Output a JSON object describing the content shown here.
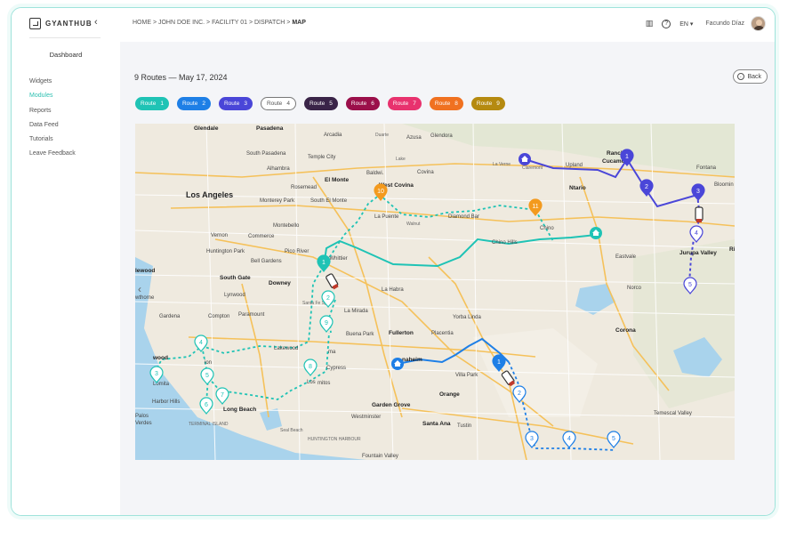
{
  "app": {
    "logo_text": "GYANTHUB",
    "collapse_glyph": "‹"
  },
  "sidebar": {
    "dashboard": "Dashboard",
    "items": [
      {
        "label": "Widgets",
        "active": false
      },
      {
        "label": "Modules",
        "active": true
      },
      {
        "label": "Reports",
        "active": false
      },
      {
        "label": "Data Feed",
        "active": false
      },
      {
        "label": "Tutorials",
        "active": false
      },
      {
        "label": "Leave Feedback",
        "active": false
      }
    ]
  },
  "header": {
    "breadcrumb": {
      "path": "HOME > JOHN DOE INC. > FACILITY  01 > DISPATCH > ",
      "current": "MAP"
    },
    "chart_icon": "▥",
    "help_icon": "?",
    "language": "EN ▾",
    "user_name": "Facundo Díaz"
  },
  "page": {
    "title": "9 Routes — May 17, 2024",
    "back_label": "Back"
  },
  "routes": [
    {
      "label": "Route",
      "num": "1",
      "color": "#1fc3b5",
      "text": "#ffffff",
      "outlined": false
    },
    {
      "label": "Route",
      "num": "2",
      "color": "#1e7fe6",
      "text": "#ffffff",
      "outlined": false
    },
    {
      "label": "Route",
      "num": "3",
      "color": "#4a46d8",
      "text": "#ffffff",
      "outlined": false
    },
    {
      "label": "Route",
      "num": "4",
      "color": "#ffffff",
      "text": "#555555",
      "outlined": true
    },
    {
      "label": "Route",
      "num": "5",
      "color": "#3a2448",
      "text": "#ffffff",
      "outlined": false
    },
    {
      "label": "Route",
      "num": "6",
      "color": "#9b0f4a",
      "text": "#ffffff",
      "outlined": false
    },
    {
      "label": "Route",
      "num": "7",
      "color": "#e8326e",
      "text": "#ffffff",
      "outlined": false
    },
    {
      "label": "Route",
      "num": "8",
      "color": "#f07120",
      "text": "#ffffff",
      "outlined": false
    },
    {
      "label": "Route",
      "num": "9",
      "color": "#b58a10",
      "text": "#ffffff",
      "outlined": false
    }
  ],
  "map": {
    "nav_prev": "‹",
    "places": {
      "glendale": "Glendale",
      "pasadena": "Pasadena",
      "arcadia": "Arcadia",
      "duarte": "Duarte",
      "azusa": "Azusa",
      "glendora": "Glendora",
      "south_pasadena": "South Pasadena",
      "temple_city": "Temple City",
      "lake": "Lake",
      "alhambra": "Alhambra",
      "baldwin": "Baldwi.",
      "covina": "Covina",
      "la_verne": "La Verne",
      "claremont": "Claremont",
      "upland": "Upland",
      "rancho": "Ranch",
      "cucamonga": "Cucamo",
      "fontana": "Fontana",
      "bloomington": "Bloomin",
      "la": "Los Angeles",
      "rosemead": "Rosemead",
      "el_monte": "El Monte",
      "west_covina": "West Covina",
      "monterey_park": "Monterey Park",
      "south_el_monte": "South El Monte",
      "ontario": "Ntario",
      "la_puente": "La Puente",
      "walnut": "Walnut",
      "diamond_bar": "Diamond Bar",
      "chino": "Chino",
      "montebello": "Montebello",
      "commerce": "Commerce",
      "chino_hills": "Chino Hills",
      "vernon": "Vernon",
      "huntington_park": "Huntington Park",
      "pico_rivera": "Pico River",
      "bell_gardens": "Bell Gardens",
      "whittier": "hWhittier",
      "eastvale": "Eastvale",
      "jurupa_valley": "Jurupa Valley",
      "inglewood": "lewood",
      "south_gate": "South Gate",
      "downey": "Downey",
      "lynwood": "Lynwood",
      "la_habra": "La Habra",
      "norco": "Norco",
      "hawthorne": "wthorne",
      "santa_fe_springs": "Santa Fe Spr",
      "la_mirada": "La Mirada",
      "gardena": "Gardena",
      "compton": "Compton",
      "paramount": "Paramount",
      "yorba_linda": "Yorba Linda",
      "buena_park": "Buena Park",
      "fullerton": "Fullerton",
      "placentia": "Placentia",
      "corona": "Corona",
      "lakewood": "Lakewood",
      "cerritos": "ma",
      "cypress": "Cypress",
      "anaheim": "naheim",
      "villa_park": "Villa Park",
      "carson": "ion",
      "torrance": "Lomita",
      "los_alamitos": "Los",
      "lamitos": "mitos",
      "orange": "Orange",
      "harbor_hills": "Harbor Hills",
      "garden_grove": "Garden Grove",
      "long_beach": "Long Beach",
      "temescal": "Temescal Valley",
      "palos": "Palos",
      "verdes": "Verdes",
      "terminal_island": "TERMINAL\nISLAND",
      "westminster": "Westminster",
      "santa_ana": "Santa Ana",
      "tustin": "Tustin",
      "seal_beach": "Seal Beach",
      "huntington_harbor": "HUNTINGTON\nHARBOUR",
      "fountain_valley": "Fountain Valley",
      "wood": "wood",
      "ri": "Ri"
    },
    "markers": {
      "teal": [
        "1",
        "2",
        "9",
        "8",
        "4",
        "3",
        "5",
        "6",
        "7"
      ],
      "orange": [
        "10",
        "11"
      ],
      "blue": [
        "1",
        "2",
        "3",
        "4",
        "5"
      ],
      "indigo": [
        "1",
        "2",
        "3",
        "4",
        "5"
      ]
    }
  }
}
